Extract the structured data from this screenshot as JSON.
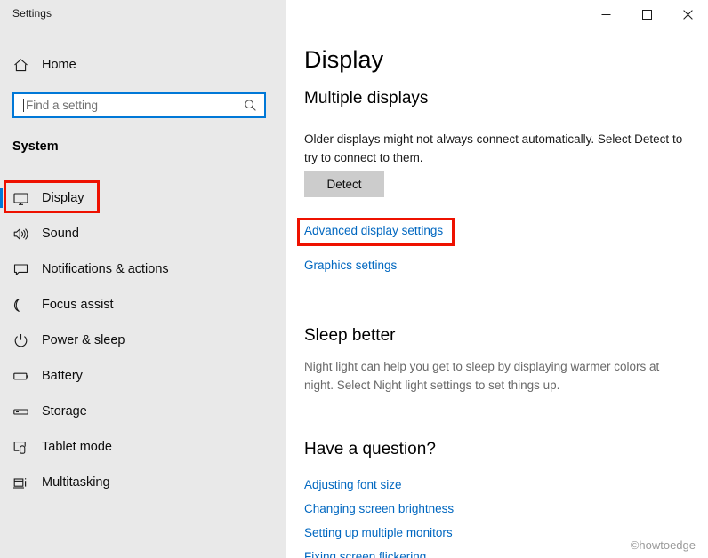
{
  "window": {
    "title": "Settings",
    "controls": {
      "minimize": "Minimize",
      "maximize": "Maximize",
      "close": "Close"
    }
  },
  "sidebar": {
    "home": {
      "label": "Home",
      "icon": "home-icon"
    },
    "search": {
      "value": "",
      "placeholder": "Find a setting",
      "icon": "search-icon"
    },
    "group_header": "System",
    "items": [
      {
        "label": "Display",
        "icon": "monitor-icon",
        "selected": true,
        "highlighted": true
      },
      {
        "label": "Sound",
        "icon": "speaker-icon",
        "selected": false,
        "highlighted": false
      },
      {
        "label": "Notifications & actions",
        "icon": "notification-icon",
        "selected": false,
        "highlighted": false
      },
      {
        "label": "Focus assist",
        "icon": "moon-icon",
        "selected": false,
        "highlighted": false
      },
      {
        "label": "Power & sleep",
        "icon": "power-icon",
        "selected": false,
        "highlighted": false
      },
      {
        "label": "Battery",
        "icon": "battery-icon",
        "selected": false,
        "highlighted": false
      },
      {
        "label": "Storage",
        "icon": "storage-icon",
        "selected": false,
        "highlighted": false
      },
      {
        "label": "Tablet mode",
        "icon": "tablet-icon",
        "selected": false,
        "highlighted": false
      },
      {
        "label": "Multitasking",
        "icon": "multitasking-icon",
        "selected": false,
        "highlighted": false
      }
    ]
  },
  "main": {
    "page_title": "Display",
    "sections": {
      "multiple_displays": {
        "title": "Multiple displays",
        "description": "Older displays might not always connect automatically. Select Detect to try to connect to them.",
        "detect_button": "Detect",
        "links": [
          {
            "label": "Advanced display settings",
            "highlighted": true
          },
          {
            "label": "Graphics settings",
            "highlighted": false
          }
        ]
      },
      "sleep_better": {
        "title": "Sleep better",
        "description": "Night light can help you get to sleep by displaying warmer colors at night. Select Night light settings to set things up."
      },
      "have_a_question": {
        "title": "Have a question?",
        "links": [
          "Adjusting font size",
          "Changing screen brightness",
          "Setting up multiple monitors",
          "Fixing screen flickering"
        ]
      }
    }
  },
  "watermark": "©howtoedge",
  "colors": {
    "accent": "#0078d7",
    "link": "#0067c0",
    "annotation": "#ee1100",
    "sidebar_bg": "#e9e9e9",
    "button_bg": "#cccccc"
  }
}
